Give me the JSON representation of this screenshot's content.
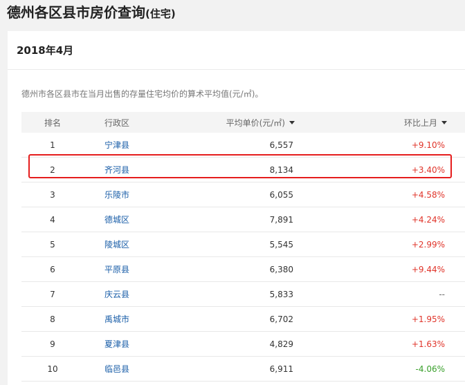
{
  "page": {
    "title": "德州各区县市房价查询",
    "title_suffix": "(住宅)"
  },
  "card": {
    "month": "2018年4月",
    "description": "德州市各区县市在当月出售的存量住宅均价的算术平均值(元/㎡)。"
  },
  "table": {
    "headers": {
      "rank": "排名",
      "district": "行政区",
      "price": "平均单价(元/㎡)",
      "change": "环比上月"
    },
    "rows": [
      {
        "rank": "1",
        "district": "宁津县",
        "price": "6,557",
        "change": "+9.10%",
        "trend": "up"
      },
      {
        "rank": "2",
        "district": "齐河县",
        "price": "8,134",
        "change": "+3.40%",
        "trend": "up"
      },
      {
        "rank": "3",
        "district": "乐陵市",
        "price": "6,055",
        "change": "+4.58%",
        "trend": "up"
      },
      {
        "rank": "4",
        "district": "德城区",
        "price": "7,891",
        "change": "+4.24%",
        "trend": "up"
      },
      {
        "rank": "5",
        "district": "陵城区",
        "price": "5,545",
        "change": "+2.99%",
        "trend": "up"
      },
      {
        "rank": "6",
        "district": "平原县",
        "price": "6,380",
        "change": "+9.44%",
        "trend": "up"
      },
      {
        "rank": "7",
        "district": "庆云县",
        "price": "5,833",
        "change": "--",
        "trend": "flat"
      },
      {
        "rank": "8",
        "district": "禹城市",
        "price": "6,702",
        "change": "+1.95%",
        "trend": "up"
      },
      {
        "rank": "9",
        "district": "夏津县",
        "price": "4,829",
        "change": "+1.63%",
        "trend": "up"
      },
      {
        "rank": "10",
        "district": "临邑县",
        "price": "6,911",
        "change": "-4.06%",
        "trend": "down"
      }
    ]
  },
  "colors": {
    "increase": "#e0342a",
    "decrease": "#3aa02c",
    "link": "#1a5ea8",
    "highlight_box": "#e51c1c"
  },
  "icons": {
    "sort_indicator": "caret-down-icon"
  }
}
